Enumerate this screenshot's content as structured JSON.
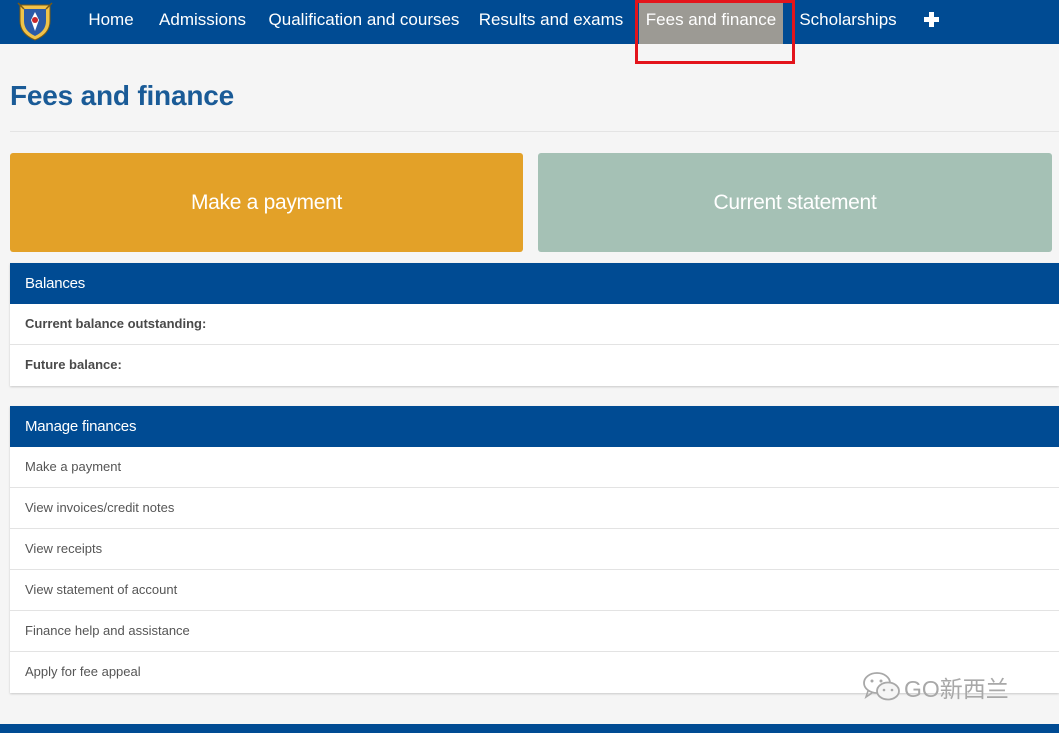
{
  "nav": {
    "items": [
      {
        "label": "Home"
      },
      {
        "label": "Admissions"
      },
      {
        "label": "Qualification and courses"
      },
      {
        "label": "Results and exams"
      },
      {
        "label": "Fees and finance",
        "active": true
      },
      {
        "label": "Scholarships"
      }
    ],
    "more_icon": "plus-icon",
    "logo_icon": "crest-logo-icon"
  },
  "page": {
    "title": "Fees and finance"
  },
  "tiles": {
    "pay_label": "Make a payment",
    "statement_label": "Current statement"
  },
  "balances": {
    "header": "Balances",
    "rows": [
      "Current balance outstanding:",
      "Future balance:"
    ]
  },
  "manage": {
    "header": "Manage finances",
    "rows": [
      "Make a payment",
      "View invoices/credit notes",
      "View receipts",
      "View statement of account",
      "Finance help and assistance",
      "Apply for fee appeal"
    ]
  },
  "watermark": {
    "text": "GO新西兰",
    "icon": "wechat-icon"
  },
  "colors": {
    "nav_bg": "#004b93",
    "active_tab": "#9c9a94",
    "highlight": "#e3141b",
    "pay_tile": "#e3a128",
    "statement_tile": "#a5c1b5",
    "title": "#1a5b97"
  }
}
